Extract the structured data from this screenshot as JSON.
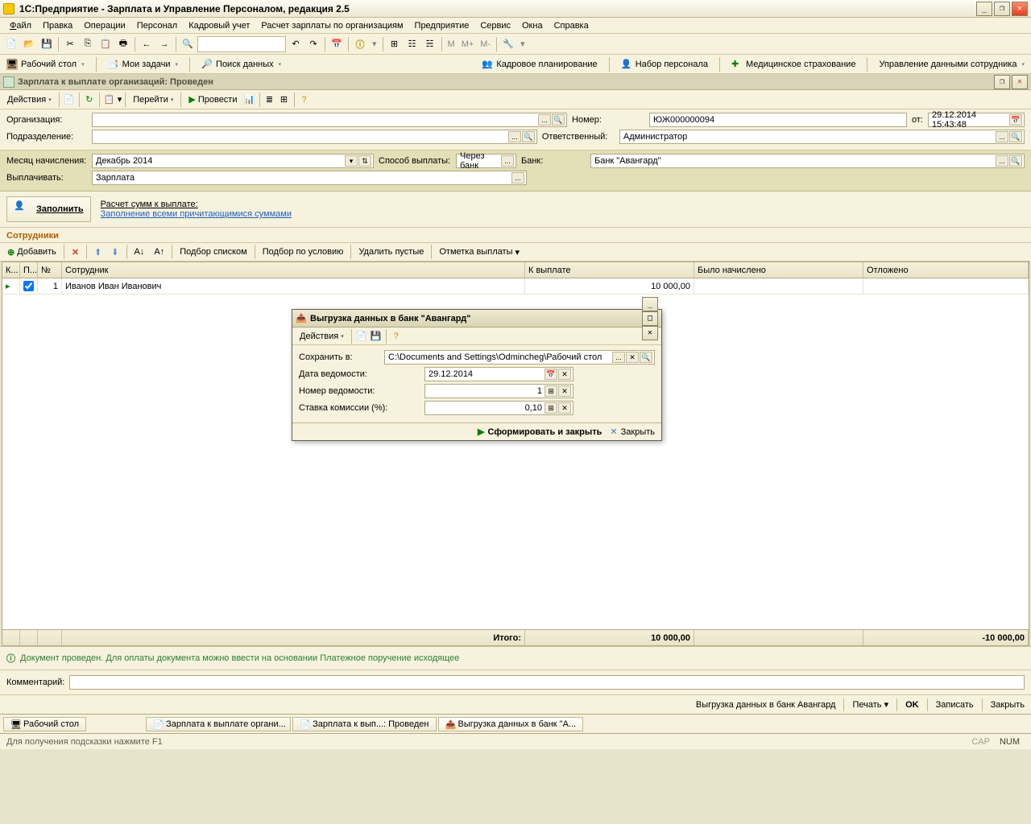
{
  "app": {
    "title": "1С:Предприятие - Зарплата и Управление Персоналом, редакция 2.5"
  },
  "menu": [
    "Файл",
    "Правка",
    "Операции",
    "Персонал",
    "Кадровый учет",
    "Расчет зарплаты по организациям",
    "Предприятие",
    "Сервис",
    "Окна",
    "Справка"
  ],
  "toolbar_markers": {
    "m": "M",
    "mplus": "M+",
    "mminus": "M-"
  },
  "panels": {
    "desktop": "Рабочий стол",
    "tasks": "Мои задачи",
    "search": "Поиск данных",
    "hr_plan": "Кадровое планирование",
    "recruit": "Набор персонала",
    "medical": "Медицинское страхование",
    "data_mgmt": "Управление данными сотрудника"
  },
  "doc": {
    "title": "Зарплата к выплате организаций: Проведен",
    "actions_label": "Действия",
    "goto_label": "Перейти",
    "provesti_label": "Провести",
    "fields": {
      "org_label": "Организация:",
      "org_value": "",
      "dept_label": "Подразделение:",
      "dept_value": "",
      "number_label": "Номер:",
      "number_value": "ЮЖ000000094",
      "from_label": "от:",
      "date_value": "29.12.2014 15:43:48",
      "resp_label": "Ответственный:",
      "resp_value": "Администратор",
      "month_label": "Месяц начисления:",
      "month_value": "Декабрь 2014",
      "pay_method_label": "Способ выплаты:",
      "pay_method_value": "Через банк",
      "bank_label": "Банк:",
      "bank_value": "Банк \"Авангард\"",
      "pay_what_label": "Выплачивать:",
      "pay_what_value": "Зарплата"
    },
    "fill": {
      "button": "Заполнить",
      "line1": "Расчет сумм к выплате:",
      "line2": "Заполнение всеми причитающимися суммами"
    },
    "employees_label": "Сотрудники",
    "table_toolbar": {
      "add": "Добавить",
      "pick_list": "Подбор списком",
      "pick_cond": "Подбор по условию",
      "del_empty": "Удалить пустые",
      "mark_pay": "Отметка выплаты"
    },
    "table": {
      "headers": {
        "k": "К...",
        "p": "П...",
        "n": "№",
        "emp": "Сотрудник",
        "to_pay": "К выплате",
        "accrued": "Было начислено",
        "deferred": "Отложено"
      },
      "row1": {
        "n": "1",
        "emp": "Иванов Иван Иванович",
        "to_pay": "10 000,00",
        "accrued": "",
        "deferred": ""
      },
      "footer": {
        "total_label": "Итого:",
        "to_pay": "10 000,00",
        "deferred": "-10 000,00"
      }
    },
    "status_msg": "Документ проведен. Для оплаты документа можно ввести на основании Платежное поручение исходящее",
    "comment_label": "Комментарий:",
    "footer": {
      "export": "Выгрузка данных в банк Авангард",
      "print": "Печать",
      "ok": "OK",
      "save": "Записать",
      "close": "Закрыть"
    }
  },
  "dialog": {
    "title": "Выгрузка данных в банк \"Авангард\"",
    "actions": "Действия",
    "save_in_label": "Сохранить в:",
    "save_in_value": "C:\\Documents and Settings\\Odmincheg\\Рабочий стол",
    "date_label": "Дата ведомости:",
    "date_value": "29.12.2014",
    "num_label": "Номер ведомости:",
    "num_value": "1",
    "rate_label": "Ставка комиссии (%):",
    "rate_value": "0,10",
    "form_btn": "Сформировать и закрыть",
    "close_btn": "Закрыть"
  },
  "taskbar": {
    "desktop": "Рабочий стол",
    "t1": "Зарплата к выплате органи...",
    "t2": "Зарплата к вып...: Проведен",
    "t3": "Выгрузка данных в банк \"А..."
  },
  "statusbar": {
    "hint": "Для получения подсказки нажмите F1",
    "cap": "CAP",
    "num": "NUM"
  }
}
